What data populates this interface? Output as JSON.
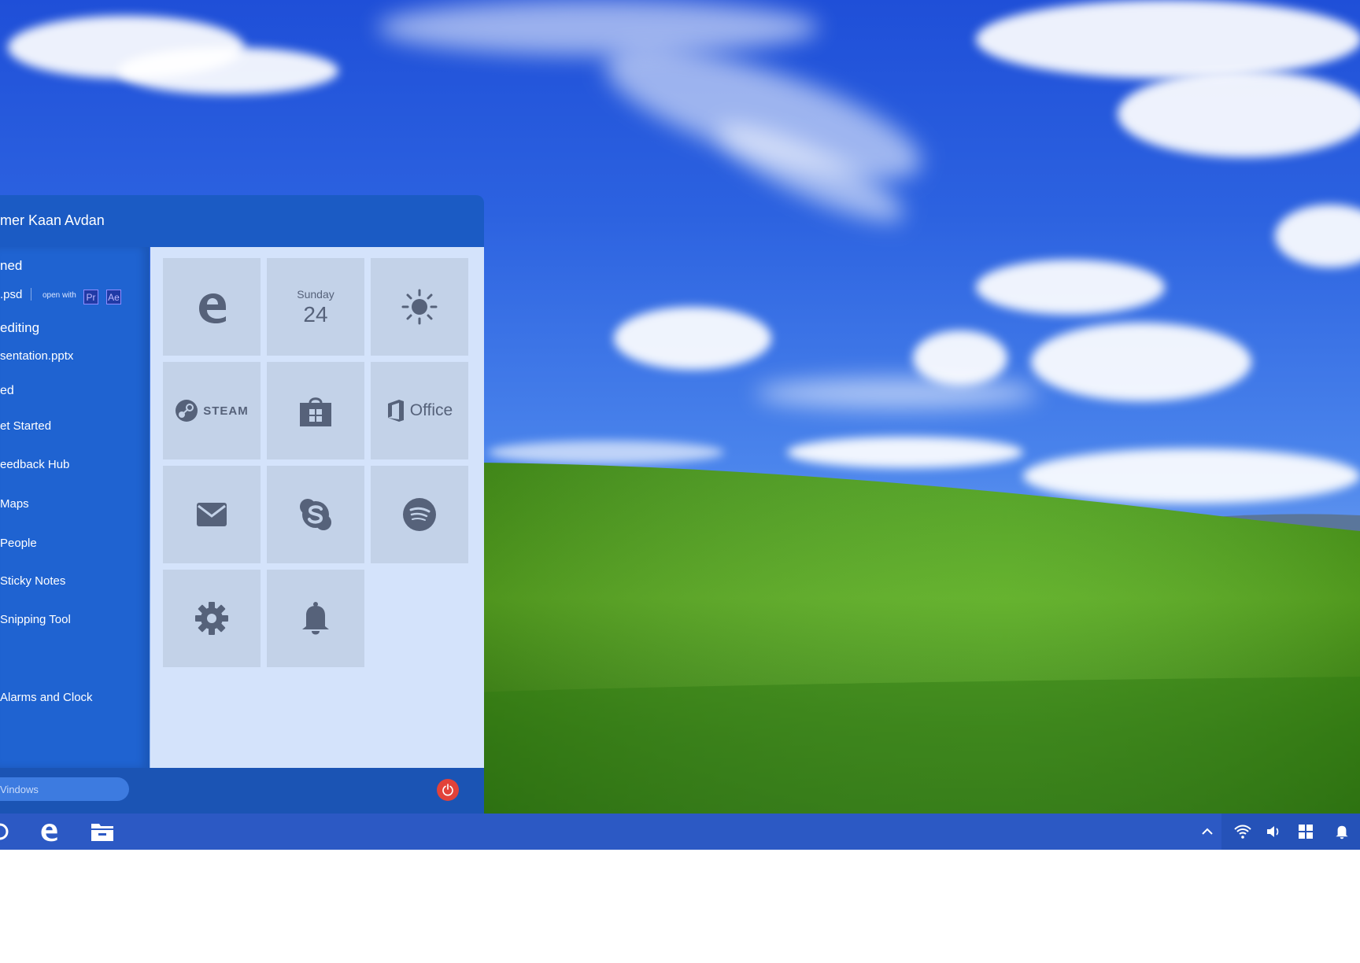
{
  "start_menu": {
    "user_name": "mer Kaan Avdan",
    "sections": {
      "pinned": "ned",
      "editing": "editing",
      "installed": "ed"
    },
    "pinned_file": {
      "name": ".psd",
      "open_with_label": "open with",
      "apps": [
        "Pr",
        "Ae"
      ]
    },
    "editing_file": "sentation.pptx",
    "apps": [
      "et Started",
      "eedback Hub",
      "Maps",
      "People",
      "Sticky Notes",
      "Snipping Tool",
      "Alarms and Clock"
    ],
    "tiles": {
      "edge_icon": "edge-icon",
      "calendar": {
        "day": "Sunday",
        "date": "24"
      },
      "weather_icon": "sun-icon",
      "steam_label": "STEAM",
      "store_icon": "store-icon",
      "office_label": "Office",
      "mail_icon": "mail-icon",
      "skype_icon": "skype-icon",
      "spotify_icon": "spotify-icon",
      "settings_icon": "gear-icon",
      "notifications_icon": "bell-icon"
    },
    "search_placeholder": "Vindows",
    "power_icon": "power-icon"
  },
  "taskbar": {
    "items": [
      "cortana-icon",
      "edge-icon",
      "file-explorer-icon"
    ],
    "tray": [
      "chevron-up-icon",
      "wifi-icon",
      "volume-icon",
      "windows-icon",
      "notification-bell-icon"
    ]
  },
  "colors": {
    "menu_header": "#1b5bc4",
    "menu_left": "#1f63d1",
    "tile_area": "#d4e3fb",
    "tile": "#c3d2e8",
    "tile_icon": "#56627a",
    "taskbar": "#2c59c4",
    "power": "#e2423a"
  }
}
